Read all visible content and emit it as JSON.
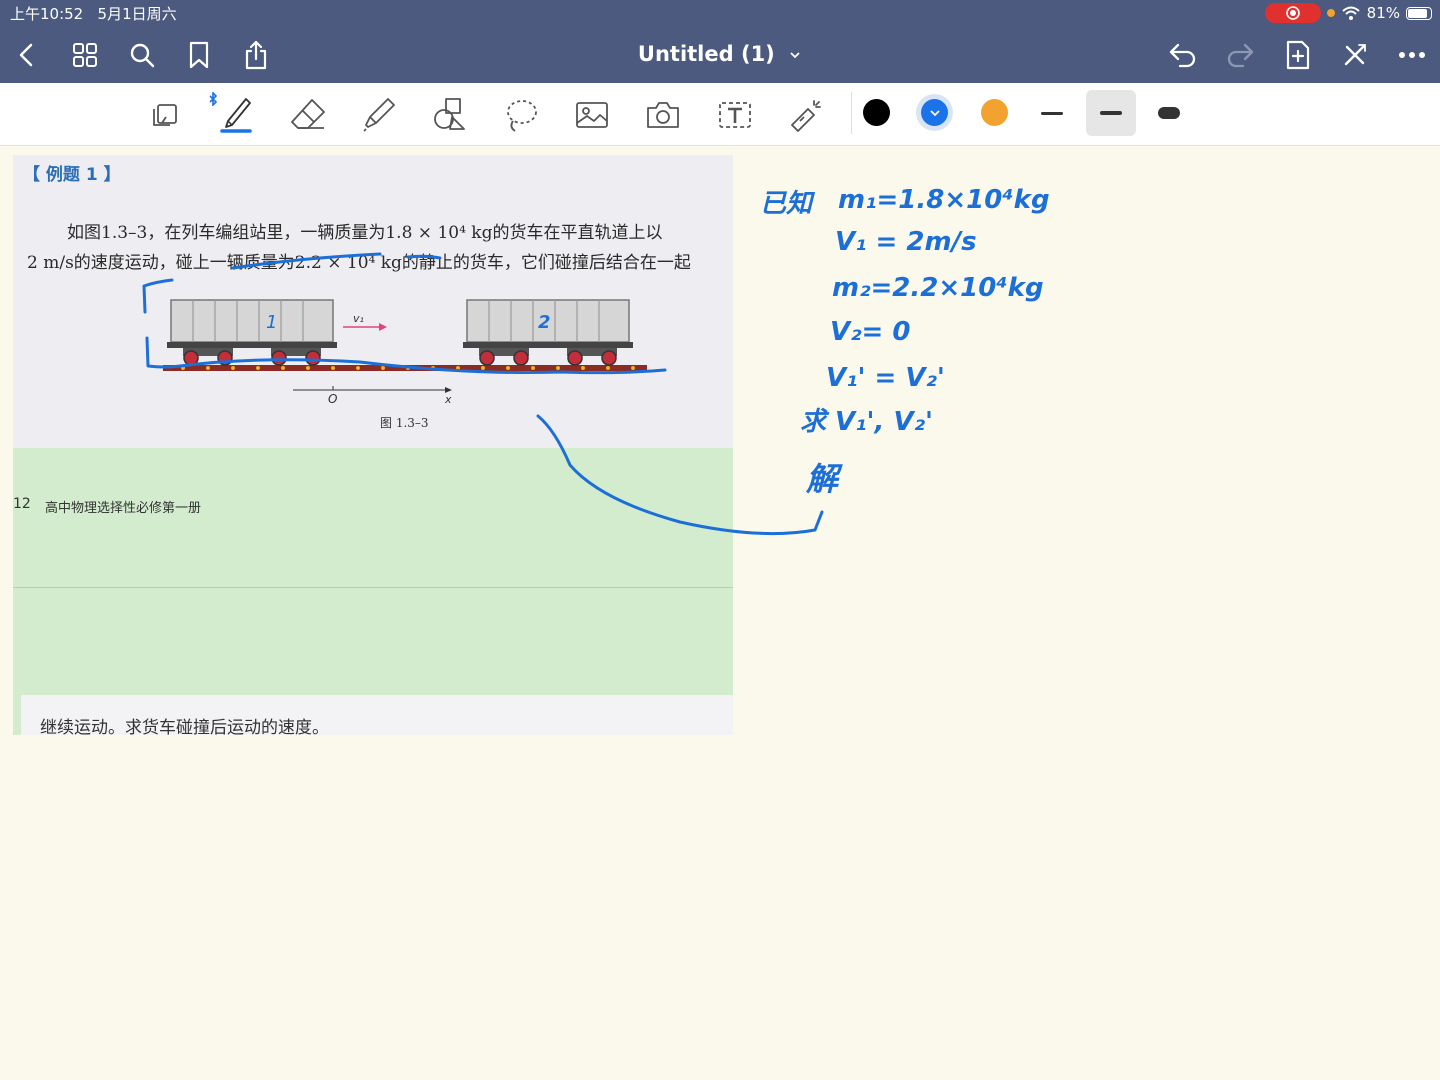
{
  "status": {
    "time": "上午10:52",
    "date": "5月1日周六",
    "battery": "81%"
  },
  "nav": {
    "title": "Untitled (1)"
  },
  "tools": {
    "icons": [
      "page-mode-icon",
      "bluetooth-icon",
      "pen-icon",
      "eraser-icon",
      "highlighter-icon",
      "shapes-icon",
      "lasso-icon",
      "image-icon",
      "camera-icon",
      "text-icon",
      "laser-pointer-icon"
    ]
  },
  "colors": {
    "swatches": [
      "#000000",
      "#1a73e8",
      "#f2a22e"
    ],
    "ink": "#1d6fd8",
    "nav_bg": "#4b5a7e"
  },
  "page": {
    "example_label": "【 例题 1 】",
    "problem_line1": "如图1.3–3，在列车编组站里，一辆质量为1.8 × 10⁴ kg的货车在平直轨道上以",
    "problem_line2": "2 m/s的速度运动，碰上一辆质量为2.2 × 10⁴ kg的静止的货车，它们碰撞后结合在一起",
    "figure": {
      "velocity_label": "v₁",
      "origin_label": "O",
      "axis_label": "x",
      "caption": "图 1.3–3"
    },
    "page_number": "12",
    "book_title": "高中物理选择性必修第一册",
    "continue_text": "继续运动。求货车碰撞后运动的速度。"
  },
  "handwriting": {
    "car1_label": "1",
    "car2_label": "2",
    "known": "已知",
    "m1": "m₁=1.8×10⁴kg",
    "v1": "V₁ = 2m/s",
    "m2": "m₂=2.2×10⁴kg",
    "v2": "V₂= 0",
    "equal": "V₁' = V₂'",
    "find": "求 V₁', V₂'",
    "solve": "解"
  }
}
